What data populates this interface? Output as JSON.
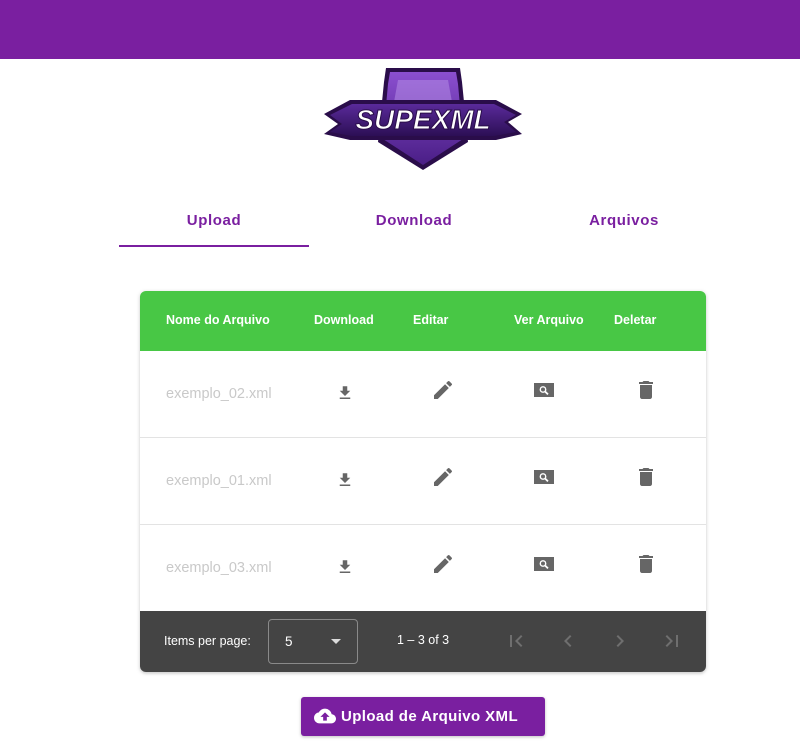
{
  "app": {
    "logo_text": "SUPEXML",
    "accent_color": "#7a1fa0",
    "header_color": "#48c745"
  },
  "tabs": [
    {
      "label": "Upload",
      "active": true
    },
    {
      "label": "Download",
      "active": false
    },
    {
      "label": "Arquivos",
      "active": false
    }
  ],
  "table": {
    "columns": [
      "Nome do Arquivo",
      "Download",
      "Editar",
      "Ver Arquivo",
      "Deletar"
    ],
    "rows": [
      {
        "name": "exemplo_02.xml",
        "icons": [
          "download-icon",
          "edit-icon",
          "view-icon",
          "delete-icon"
        ]
      },
      {
        "name": "exemplo_01.xml",
        "icons": [
          "download-icon",
          "edit-icon",
          "view-icon",
          "delete-icon"
        ]
      },
      {
        "name": "exemplo_03.xml",
        "icons": [
          "download-icon",
          "edit-icon",
          "view-icon",
          "delete-icon"
        ]
      }
    ]
  },
  "paginator": {
    "items_per_page_label": "Items per page:",
    "page_size": "5",
    "range_label": "1 – 3 of 3",
    "icons": [
      "first-page-icon",
      "previous-page-icon",
      "next-page-icon",
      "last-page-icon"
    ]
  },
  "upload_button": {
    "label": "Upload de Arquivo XML",
    "icon": "cloud-upload-icon"
  }
}
